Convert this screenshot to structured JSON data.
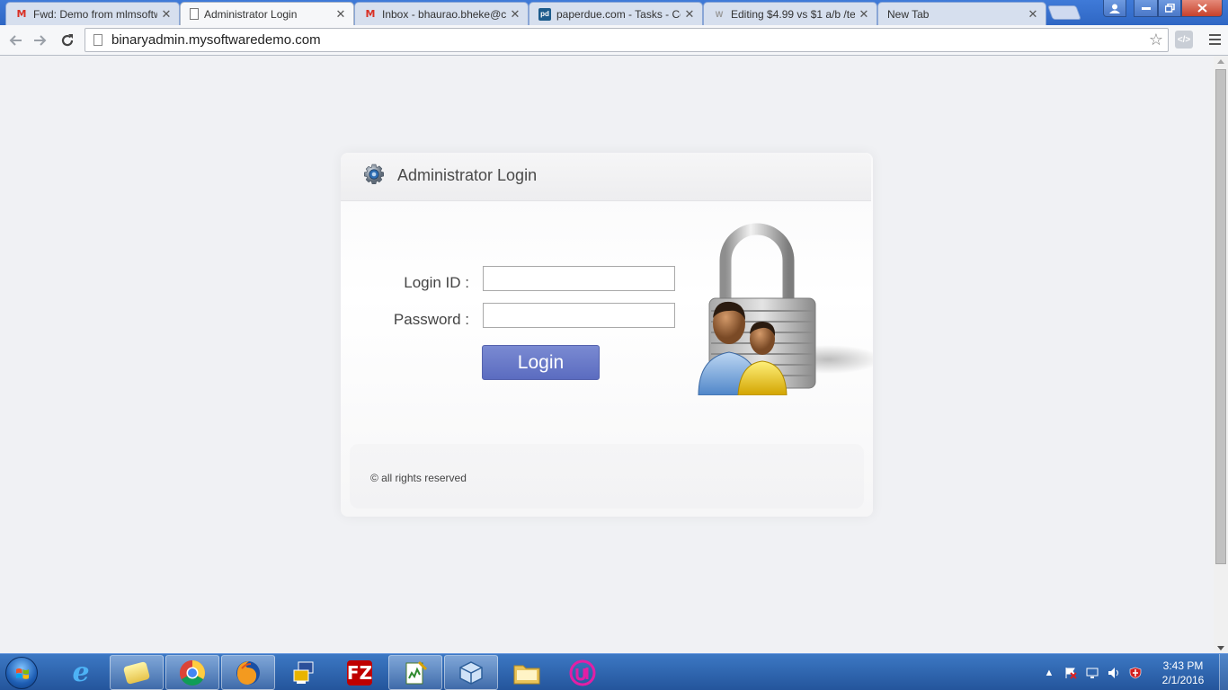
{
  "browser": {
    "tabs": [
      {
        "title": "Fwd: Demo from mlmsoftw",
        "favicon": "gmail-icon",
        "active": false
      },
      {
        "title": "Administrator Login",
        "favicon": "page-icon",
        "active": true
      },
      {
        "title": "Inbox - bhaurao.bheke@c",
        "favicon": "gmail-icon",
        "active": false
      },
      {
        "title": "paperdue.com - Tasks - Co",
        "favicon": "paperdue-icon",
        "active": false
      },
      {
        "title": "Editing $4.99 vs $1 a/b /te",
        "favicon": "wix-icon",
        "active": false
      },
      {
        "title": "New Tab",
        "favicon": "none",
        "active": false
      }
    ],
    "address": "binaryadmin.mysoftwaredemo.com"
  },
  "login": {
    "title": "Administrator Login",
    "login_id_label": "Login ID :",
    "password_label": "Password :",
    "login_id_value": "",
    "password_value": "",
    "button_label": "Login",
    "footer": "© all rights reserved"
  },
  "taskbar": {
    "pinned": [
      "internet-explorer-icon",
      "file-explorer-icon",
      "chrome-icon",
      "firefox-icon",
      "remote-desktop-icon",
      "filezilla-icon",
      "notepad-icon",
      "virtualbox-icon",
      "folder-icon",
      "app-icon"
    ],
    "time": "3:43 PM",
    "date": "2/1/2016"
  },
  "colors": {
    "login_button": "#6676c9",
    "page_background": "#f0f1f4",
    "taskbar": "#2f66b0"
  }
}
